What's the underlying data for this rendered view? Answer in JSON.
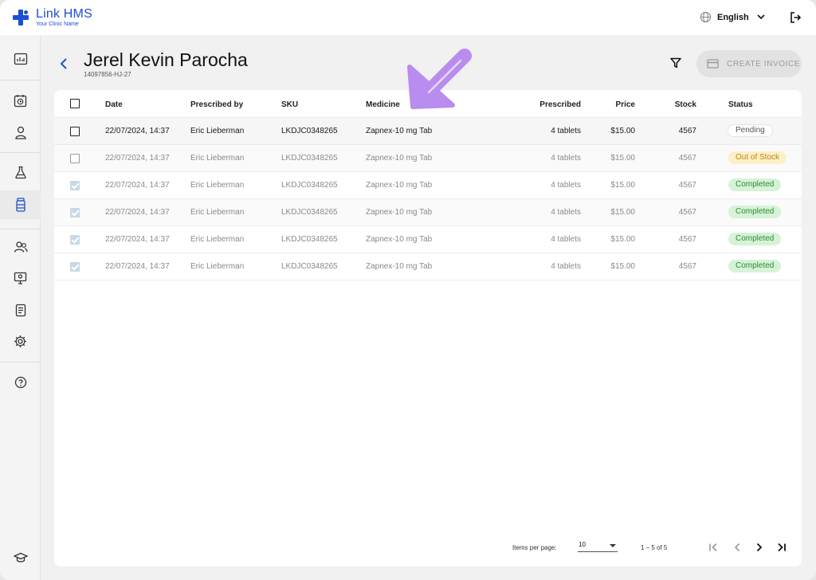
{
  "app": {
    "name": "Link HMS",
    "tagline": "Your Clinic Name"
  },
  "topbar": {
    "language": "English"
  },
  "patient": {
    "name": "Jerel Kevin Parocha",
    "id": "14097856-HJ-27"
  },
  "actions": {
    "create_invoice": "CREATE INVOICE"
  },
  "table": {
    "headers": {
      "date": "Date",
      "prescribed_by": "Prescribed by",
      "sku": "SKU",
      "medicine": "Medicine",
      "prescribed": "Prescribed",
      "price": "Price",
      "stock": "Stock",
      "status": "Status"
    },
    "rows": [
      {
        "date": "22/07/2024, 14:37",
        "prescribed_by": "Eric Lieberman",
        "sku": "LKDJC0348265",
        "medicine": "Zapnex-10 mg Tab",
        "prescribed": "4 tablets",
        "price": "$15.00",
        "stock": "4567",
        "status": "Pending",
        "checkbox": "unchecked"
      },
      {
        "date": "22/07/2024, 14:37",
        "prescribed_by": "Eric Lieberman",
        "sku": "LKDJC0348265",
        "medicine": "Zapnex-10 mg Tab",
        "prescribed": "4 tablets",
        "price": "$15.00",
        "stock": "4567",
        "status": "Out of Stock",
        "checkbox": "unchecked-disabled"
      },
      {
        "date": "22/07/2024, 14:37",
        "prescribed_by": "Eric Lieberman",
        "sku": "LKDJC0348265",
        "medicine": "Zapnex-10 mg Tab",
        "prescribed": "4 tablets",
        "price": "$15.00",
        "stock": "4567",
        "status": "Completed",
        "checkbox": "checked-disabled"
      },
      {
        "date": "22/07/2024, 14:37",
        "prescribed_by": "Eric Lieberman",
        "sku": "LKDJC0348265",
        "medicine": "Zapnex-10 mg Tab",
        "prescribed": "4 tablets",
        "price": "$15.00",
        "stock": "4567",
        "status": "Completed",
        "checkbox": "checked-disabled"
      },
      {
        "date": "22/07/2024, 14:37",
        "prescribed_by": "Eric Lieberman",
        "sku": "LKDJC0348265",
        "medicine": "Zapnex-10 mg Tab",
        "prescribed": "4 tablets",
        "price": "$15.00",
        "stock": "4567",
        "status": "Completed",
        "checkbox": "checked-disabled"
      },
      {
        "date": "22/07/2024, 14:37",
        "prescribed_by": "Eric Lieberman",
        "sku": "LKDJC0348265",
        "medicine": "Zapnex-10 mg Tab",
        "prescribed": "4 tablets",
        "price": "$15.00",
        "stock": "4567",
        "status": "Completed",
        "checkbox": "checked-disabled"
      }
    ]
  },
  "pagination": {
    "items_per_page_label": "Items per page:",
    "items_per_page": "10",
    "range": "1 – 5 of 5"
  },
  "icons": {
    "sidebar": [
      "dashboard-icon",
      "appointments-icon",
      "patient-icon",
      "lab-icon",
      "pharmacy-icon",
      "staff-icon",
      "monitor-icon",
      "reports-icon",
      "settings-icon",
      "help-icon",
      "education-icon"
    ],
    "topbar": [
      "globe-icon",
      "chevron-down-icon",
      "logout-icon"
    ]
  },
  "colors": {
    "brand": "#1f4fd1",
    "pending": "#555555",
    "out_of_stock_bg": "#fdf0c8",
    "out_of_stock_text": "#b88a07",
    "completed_bg": "#d6f3d7",
    "completed_text": "#2f8a34",
    "annotation": "#b98cf0"
  }
}
